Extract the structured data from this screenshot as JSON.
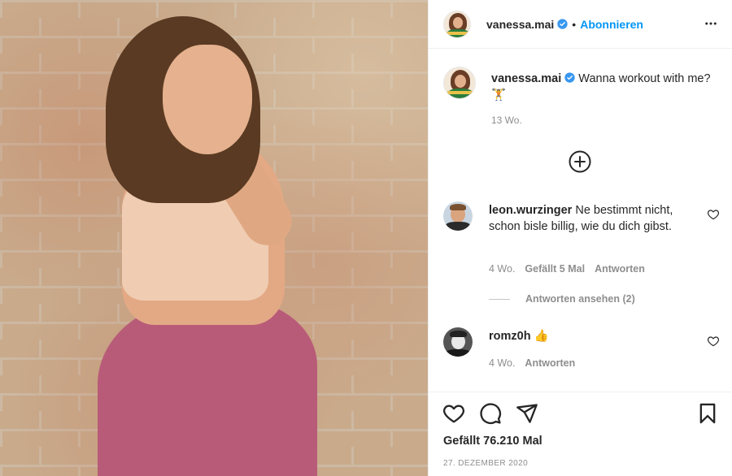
{
  "post": {
    "image_alt": "photo",
    "header": {
      "username": "vanessa.mai",
      "separator": "•",
      "follow_label": "Abonnieren"
    },
    "caption": {
      "username": "vanessa.mai",
      "text": "Wanna workout with me?",
      "emoji": "🏋",
      "time": "13 Wo."
    },
    "comments": [
      {
        "username": "leon.wurzinger",
        "text": "Ne bestimmt nicht, schon bisle billig, wie du dich gibst.",
        "time": "4 Wo.",
        "likes": "Gefällt 5 Mal",
        "reply": "Antworten",
        "view_replies": "Antworten ansehen (2)"
      },
      {
        "username": "romz0h",
        "text": "👍",
        "time": "4 Wo.",
        "reply": "Antworten"
      }
    ],
    "likes": "Gefällt 76.210 Mal",
    "date": "27. DEZEMBER 2020"
  },
  "colors": {
    "accent": "#0095f6",
    "verified": "#3897f0",
    "muted": "#8e8e8e",
    "text": "#262626"
  }
}
